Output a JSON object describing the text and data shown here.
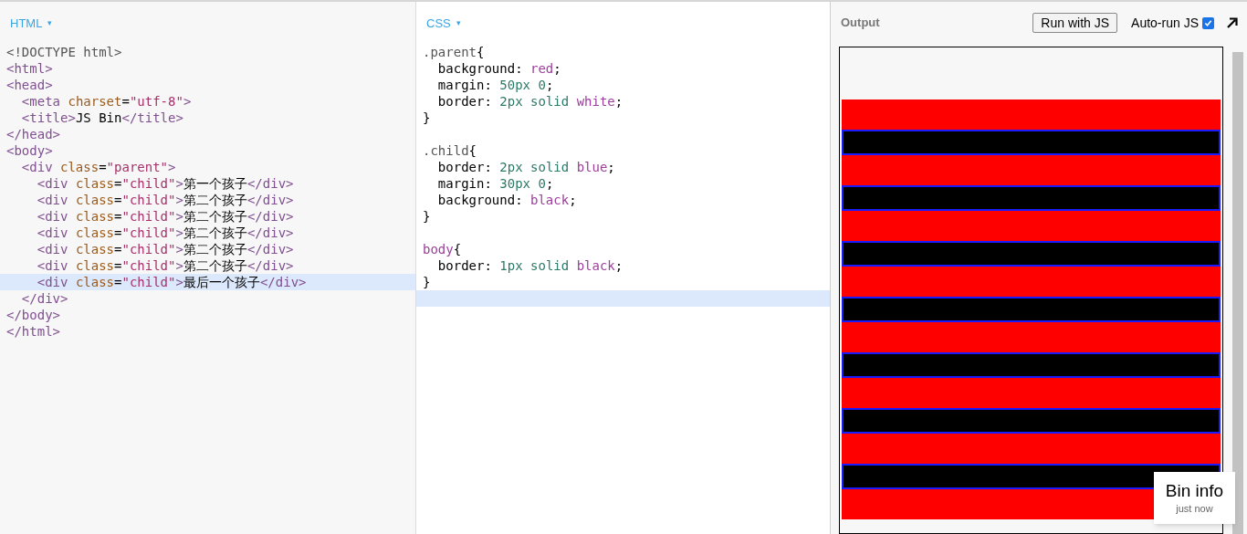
{
  "html_panel": {
    "title": "HTML",
    "caret": "▾",
    "lines": [
      {
        "text": "<!DOCTYPE html>",
        "active": false
      },
      {
        "text": "<html>",
        "active": false
      },
      {
        "text": "<head>",
        "active": false
      },
      {
        "text": "  <meta charset=\"utf-8\">",
        "active": false
      },
      {
        "text": "  <title>JS Bin</title>",
        "active": false
      },
      {
        "text": "</head>",
        "active": false
      },
      {
        "text": "<body>",
        "active": false
      },
      {
        "text": "  <div class=\"parent\">",
        "active": false
      },
      {
        "text": "    <div class=\"child\">第一个孩子</div>",
        "active": false
      },
      {
        "text": "    <div class=\"child\">第二个孩子</div>",
        "active": false
      },
      {
        "text": "    <div class=\"child\">第二个孩子</div>",
        "active": false
      },
      {
        "text": "    <div class=\"child\">第二个孩子</div>",
        "active": false
      },
      {
        "text": "    <div class=\"child\">第二个孩子</div>",
        "active": false
      },
      {
        "text": "    <div class=\"child\">第二个孩子</div>",
        "active": false
      },
      {
        "text": "    <div class=\"child\">最后一个孩子</div>",
        "active": true
      },
      {
        "text": "  </div>",
        "active": false
      },
      {
        "text": "</body>",
        "active": false
      },
      {
        "text": "</html>",
        "active": false
      }
    ]
  },
  "css_panel": {
    "title": "CSS",
    "caret": "▾",
    "lines": [
      {
        "text": ".parent{",
        "active": false
      },
      {
        "text": "  background: red;",
        "active": false
      },
      {
        "text": "  margin: 50px 0;",
        "active": false
      },
      {
        "text": "  border: 2px solid white;",
        "active": false
      },
      {
        "text": "}",
        "active": false
      },
      {
        "active": false
      },
      {
        "text": ".child{",
        "active": false
      },
      {
        "text": "  border: 2px solid blue;",
        "active": false
      },
      {
        "text": "  margin: 30px 0;",
        "active": false
      },
      {
        "text": "  background: black;",
        "active": false
      },
      {
        "text": "}",
        "active": false
      },
      {
        "active": false
      },
      {
        "text": "body{",
        "active": false
      },
      {
        "text": "  border: 1px solid black;",
        "active": false
      },
      {
        "text": "}",
        "active": false
      },
      {
        "active": true
      }
    ]
  },
  "output_panel": {
    "title": "Output",
    "run_button": "Run with JS",
    "auto_run": {
      "label": "Auto-run JS",
      "checked": true
    }
  },
  "bin_info": {
    "title": "Bin info",
    "time": "just now"
  }
}
